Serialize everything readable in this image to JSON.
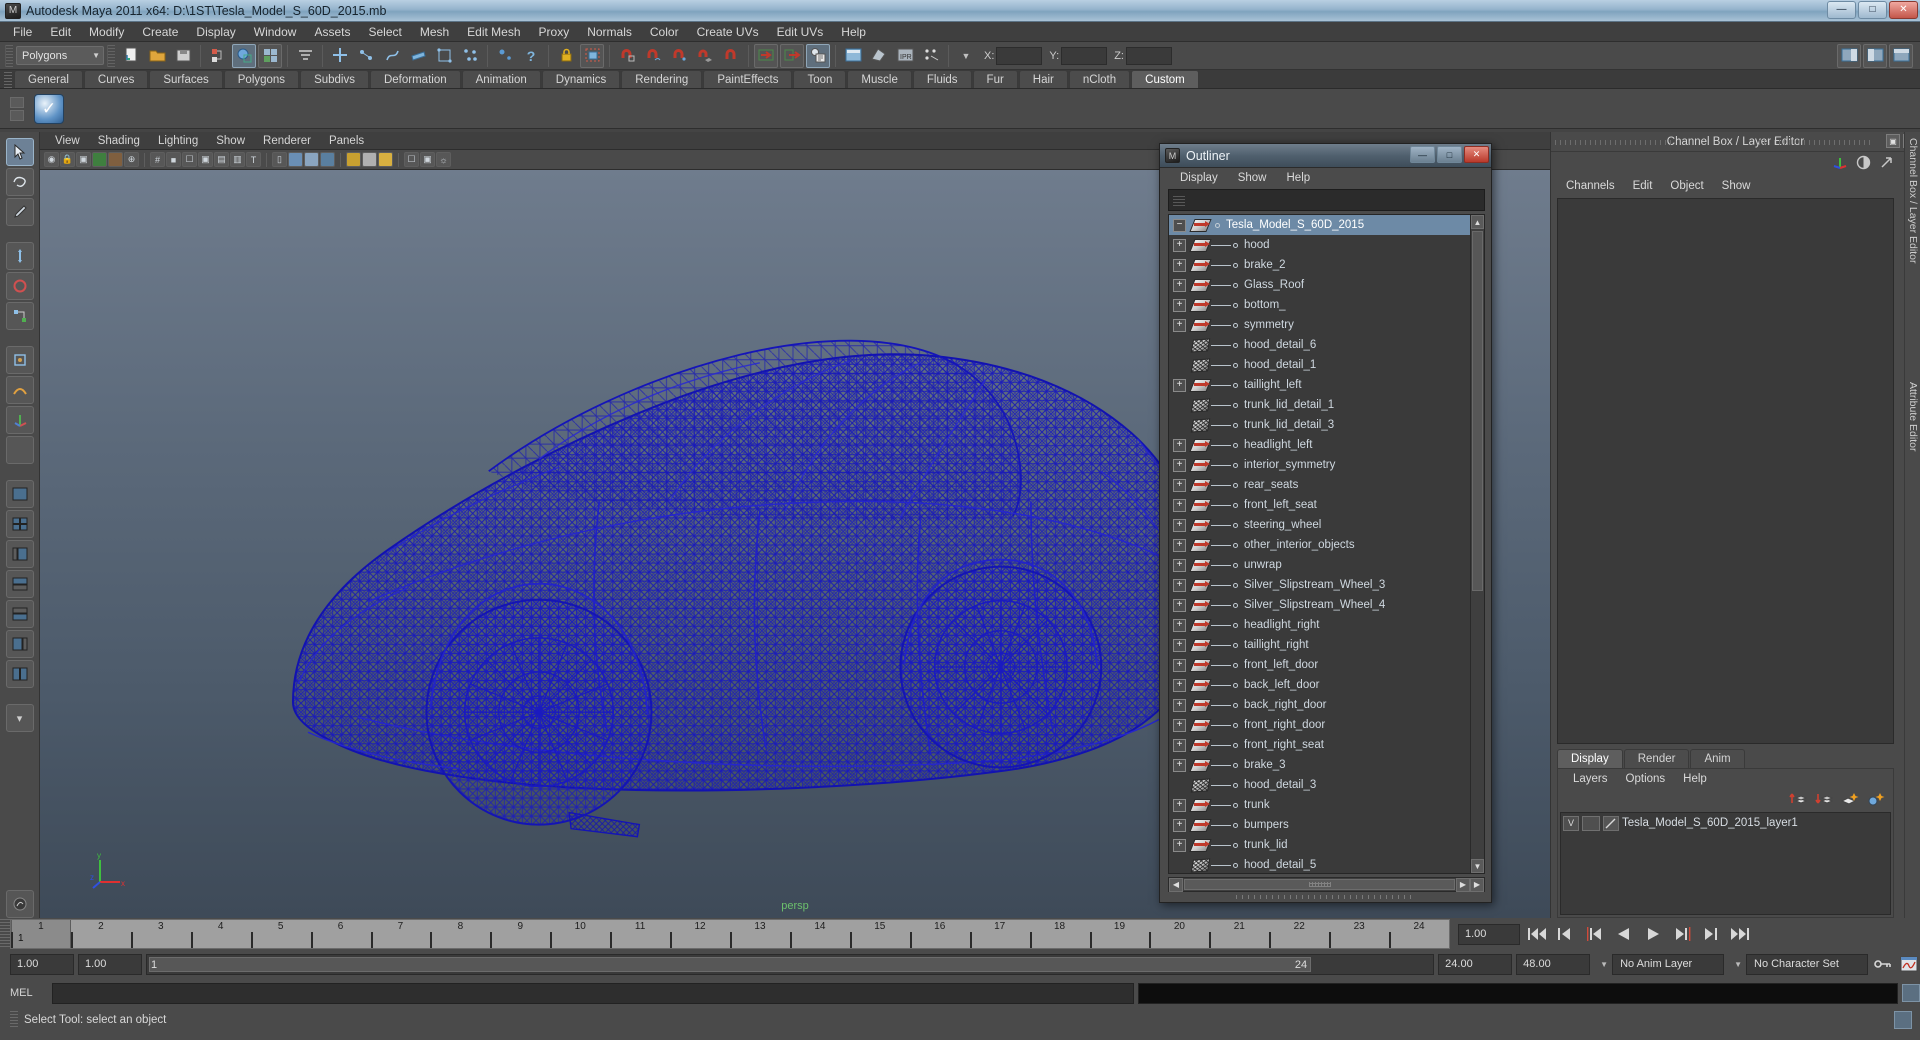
{
  "app": {
    "title": "Autodesk Maya 2011 x64: D:\\1ST\\Tesla_Model_S_60D_2015.mb",
    "icon": "maya-icon",
    "window_buttons": [
      {
        "name": "minimize",
        "glyph": "—"
      },
      {
        "name": "maximize",
        "glyph": "□"
      },
      {
        "name": "close",
        "glyph": "✕"
      }
    ]
  },
  "menubar": {
    "items": [
      "File",
      "Edit",
      "Modify",
      "Create",
      "Display",
      "Window",
      "Assets",
      "Select",
      "Mesh",
      "Edit Mesh",
      "Proxy",
      "Normals",
      "Color",
      "Create UVs",
      "Edit UVs",
      "Help"
    ]
  },
  "toolbar": {
    "mode_menu": "Polygons",
    "coord_labels": [
      "X:",
      "Y:",
      "Z:"
    ],
    "coord_values": [
      "",
      "",
      ""
    ]
  },
  "shelf": {
    "tabs": [
      "General",
      "Curves",
      "Surfaces",
      "Polygons",
      "Subdivs",
      "Deformation",
      "Animation",
      "Dynamics",
      "Rendering",
      "PaintEffects",
      "Toon",
      "Muscle",
      "Fluids",
      "Fur",
      "Hair",
      "nCloth",
      "Custom"
    ],
    "active_tab": "Custom"
  },
  "viewport": {
    "menus": [
      "View",
      "Shading",
      "Lighting",
      "Show",
      "Renderer",
      "Panels"
    ],
    "camera_label": "persp",
    "axis_labels": {
      "x": "x",
      "y": "y",
      "z": "z"
    },
    "wireframe_color": "#1414b4"
  },
  "outliner": {
    "title": "Outliner",
    "menus": [
      "Display",
      "Show",
      "Help"
    ],
    "search_value": "",
    "window_buttons": [
      {
        "name": "minimize",
        "glyph": "—"
      },
      {
        "name": "maximize",
        "glyph": "□"
      },
      {
        "name": "close",
        "glyph": "✕"
      }
    ],
    "items": [
      {
        "label": "Tesla_Model_S_60D_2015",
        "expand": "minus",
        "icon": "transform-icon",
        "root": true,
        "selected": true
      },
      {
        "label": "hood",
        "expand": "plus",
        "icon": "transform-icon"
      },
      {
        "label": "brake_2",
        "expand": "plus",
        "icon": "transform-icon"
      },
      {
        "label": "Glass_Roof",
        "expand": "plus",
        "icon": "transform-icon"
      },
      {
        "label": "bottom_",
        "expand": "plus",
        "icon": "transform-icon"
      },
      {
        "label": "symmetry",
        "expand": "plus",
        "icon": "transform-icon"
      },
      {
        "label": "hood_detail_6",
        "expand": "none",
        "icon": "mesh-icon"
      },
      {
        "label": "hood_detail_1",
        "expand": "none",
        "icon": "mesh-icon"
      },
      {
        "label": "taillight_left",
        "expand": "plus",
        "icon": "transform-icon"
      },
      {
        "label": "trunk_lid_detail_1",
        "expand": "none",
        "icon": "mesh-icon"
      },
      {
        "label": "trunk_lid_detail_3",
        "expand": "none",
        "icon": "mesh-icon"
      },
      {
        "label": "headlight_left",
        "expand": "plus",
        "icon": "transform-icon"
      },
      {
        "label": "interior_symmetry",
        "expand": "plus",
        "icon": "transform-icon"
      },
      {
        "label": "rear_seats",
        "expand": "plus",
        "icon": "transform-icon"
      },
      {
        "label": "front_left_seat",
        "expand": "plus",
        "icon": "transform-icon"
      },
      {
        "label": "steering_wheel",
        "expand": "plus",
        "icon": "transform-icon"
      },
      {
        "label": "other_interior_objects",
        "expand": "plus",
        "icon": "transform-icon"
      },
      {
        "label": "unwrap",
        "expand": "plus",
        "icon": "transform-icon"
      },
      {
        "label": "Silver_Slipstream_Wheel_3",
        "expand": "plus",
        "icon": "transform-icon"
      },
      {
        "label": "Silver_Slipstream_Wheel_4",
        "expand": "plus",
        "icon": "transform-icon"
      },
      {
        "label": "headlight_right",
        "expand": "plus",
        "icon": "transform-icon"
      },
      {
        "label": "taillight_right",
        "expand": "plus",
        "icon": "transform-icon"
      },
      {
        "label": "front_left_door",
        "expand": "plus",
        "icon": "transform-icon"
      },
      {
        "label": "back_left_door",
        "expand": "plus",
        "icon": "transform-icon"
      },
      {
        "label": "back_right_door",
        "expand": "plus",
        "icon": "transform-icon"
      },
      {
        "label": "front_right_door",
        "expand": "plus",
        "icon": "transform-icon"
      },
      {
        "label": "front_right_seat",
        "expand": "plus",
        "icon": "transform-icon"
      },
      {
        "label": "brake_3",
        "expand": "plus",
        "icon": "transform-icon"
      },
      {
        "label": "hood_detail_3",
        "expand": "none",
        "icon": "mesh-icon"
      },
      {
        "label": "trunk",
        "expand": "plus",
        "icon": "transform-icon"
      },
      {
        "label": "bumpers",
        "expand": "plus",
        "icon": "transform-icon"
      },
      {
        "label": "trunk_lid",
        "expand": "plus",
        "icon": "transform-icon"
      },
      {
        "label": "hood_detail_5",
        "expand": "none",
        "icon": "mesh-icon"
      }
    ]
  },
  "channel_box": {
    "title": "Channel Box / Layer Editor",
    "menus": [
      "Channels",
      "Edit",
      "Object",
      "Show"
    ],
    "side_tab": "Channel Box / Layer Editor",
    "window_buttons": [
      {
        "name": "float",
        "glyph": "▣"
      },
      {
        "name": "close",
        "glyph": "✕"
      }
    ]
  },
  "layer_editor": {
    "tabs": [
      "Display",
      "Render",
      "Anim"
    ],
    "active_tab": "Display",
    "menus": [
      "Layers",
      "Options",
      "Help"
    ],
    "layers": [
      {
        "visible": "V",
        "playback": "",
        "name": "Tesla_Model_S_60D_2015_layer1"
      }
    ]
  },
  "attribute_editor": {
    "side_tab": "Attribute Editor"
  },
  "timeline": {
    "ticks": [
      1,
      2,
      3,
      4,
      5,
      6,
      7,
      8,
      9,
      10,
      11,
      12,
      13,
      14,
      15,
      16,
      17,
      18,
      19,
      20,
      21,
      22,
      23,
      24
    ],
    "current_frame": "1",
    "current_frame_field": "1.00",
    "playback_buttons": [
      "go-to-start",
      "step-back-key",
      "step-back-frame",
      "play-backwards",
      "play-forwards",
      "step-forward-frame",
      "step-forward-key",
      "go-to-end"
    ]
  },
  "range_slider": {
    "anim_start": "1.00",
    "anim_end": "1.00",
    "range_start": "1",
    "range_end": "24",
    "playback_end": "24.00",
    "anim_end_field": "48.00",
    "anim_layer": "No Anim Layer",
    "character_set": "No Character Set"
  },
  "command_line": {
    "label": "MEL",
    "input_value": "",
    "output_value": ""
  },
  "status_line": {
    "message": "Select Tool: select an object"
  }
}
